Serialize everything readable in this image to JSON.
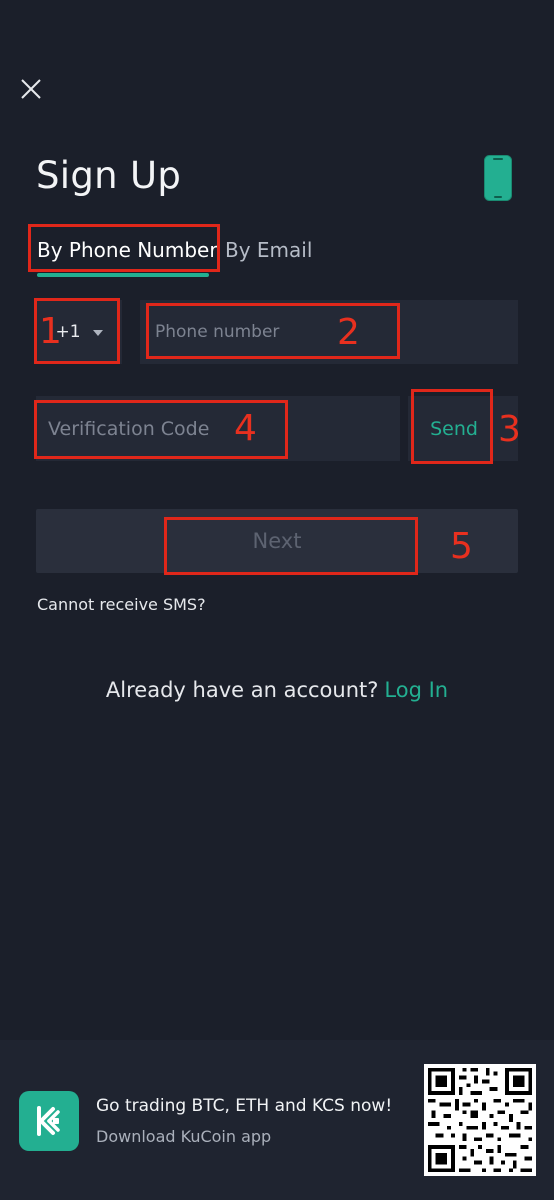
{
  "header": {
    "title": "Sign Up"
  },
  "tabs": [
    {
      "label": "By Phone Number",
      "active": true
    },
    {
      "label": "By Email",
      "active": false
    }
  ],
  "form": {
    "country_code": "+1",
    "phone_placeholder": "Phone number",
    "code_placeholder": "Verification Code",
    "send_label": "Send",
    "next_label": "Next",
    "sms_help": "Cannot receive SMS?"
  },
  "login": {
    "prompt": "Already have an account?",
    "link": "Log In"
  },
  "annotations": [
    "1",
    "2",
    "3",
    "4",
    "5"
  ],
  "footer": {
    "title": "Go trading BTC, ETH and KCS now!",
    "subtitle": "Download KuCoin app"
  },
  "colors": {
    "background": "#1b1f2a",
    "accent": "#23af91",
    "annotation": "#e0271a"
  },
  "icons": [
    "close-icon",
    "phone-icon",
    "chevron-down-icon",
    "kucoin-logo-icon",
    "qr-code-icon"
  ]
}
